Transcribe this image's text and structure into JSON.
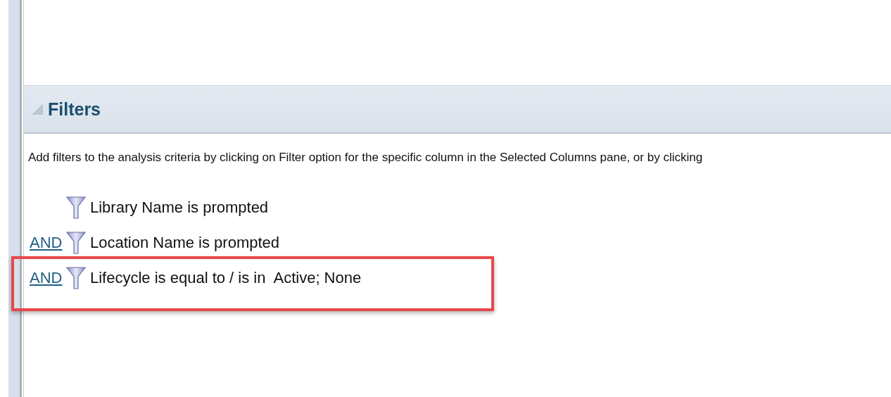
{
  "section": {
    "title": "Filters",
    "expanded": true
  },
  "description": "Add filters to the analysis criteria by clicking on Filter option for the specific column in the Selected Columns pane, or by clicking",
  "filters": [
    {
      "text": "Library Name is prompted",
      "highlighted": false
    },
    {
      "connector": "AND",
      "text": "Location Name is prompted",
      "highlighted": false
    },
    {
      "connector": "AND",
      "text": "Lifecycle is equal to / is in  Active; None",
      "highlighted": true
    }
  ]
}
